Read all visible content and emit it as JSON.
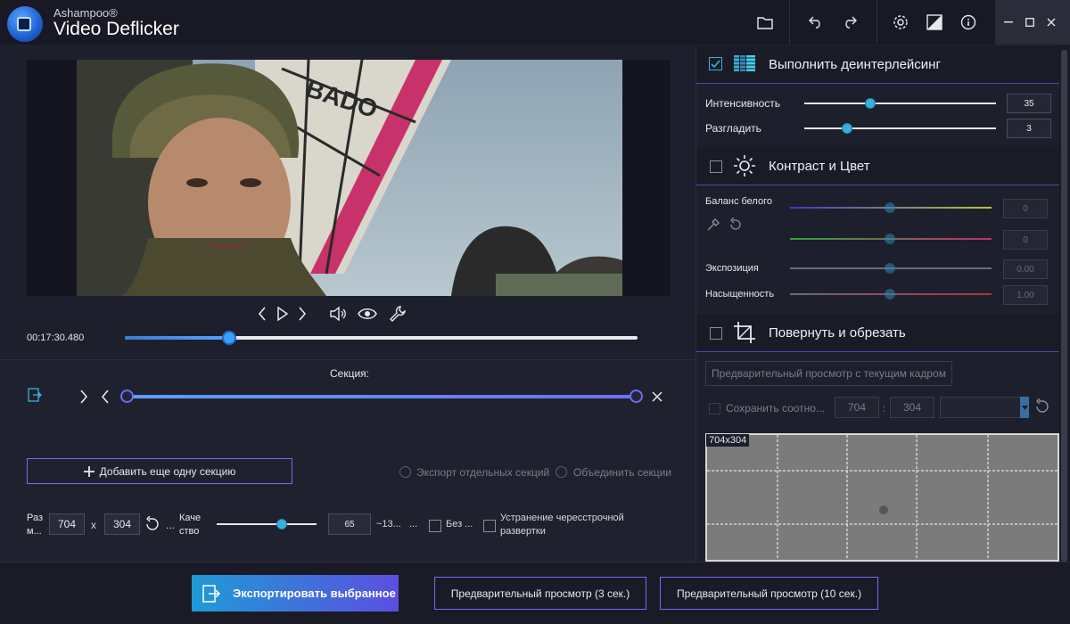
{
  "titlebar": {
    "brand": "Ashampoo®",
    "product": "Video Deflicker"
  },
  "player": {
    "timecode": "00:17:30.480",
    "progress": 0.21
  },
  "section": {
    "label": "Секция:",
    "add_button": "Добавить еще одну секцию",
    "export_separate": "Экспорт отдельных секций",
    "merge": "Объединить секции"
  },
  "output": {
    "size_label_1": "Раз",
    "size_label_2": "м...",
    "width": "704",
    "x": "x",
    "height": "304",
    "ellipsis": "...",
    "quality_label_1": "Каче",
    "quality_label_2": "ство",
    "quality_value": "65",
    "quality_extra": "~13...",
    "quality_extra2": "...",
    "no_label": "Без ...",
    "deinterlace_label_1": "Устранение чересстрочной",
    "deinterlace_label_2": "развертки"
  },
  "deinterlace": {
    "title": "Выполнить деинтерлейсинг",
    "intensity_label": "Интенсивность",
    "intensity_value": "35",
    "smooth_label": "Разгладить",
    "smooth_value": "3"
  },
  "contrast": {
    "title": "Контраст и Цвет",
    "white_balance_label": "Баланс белого",
    "wb1_value": "0",
    "wb2_value": "0",
    "exposure_label": "Экспозиция",
    "exposure_value": "0.00",
    "saturation_label": "Насыщенность",
    "saturation_value": "1.00"
  },
  "rotate": {
    "title": "Повернуть и обрезать",
    "preview_frame_button": "Предварительный просмотр с текущим кадром",
    "keep_ratio_label": "Сохранить соотно...",
    "crop_width": "704",
    "colon": ":",
    "crop_height": "304",
    "crop_label": "704x304"
  },
  "bottom": {
    "export_button": "Экспортировать выбранное",
    "preview3": "Предварительный просмотр (3 сек.)",
    "preview10": "Предварительный просмотр (10 сек.)"
  }
}
